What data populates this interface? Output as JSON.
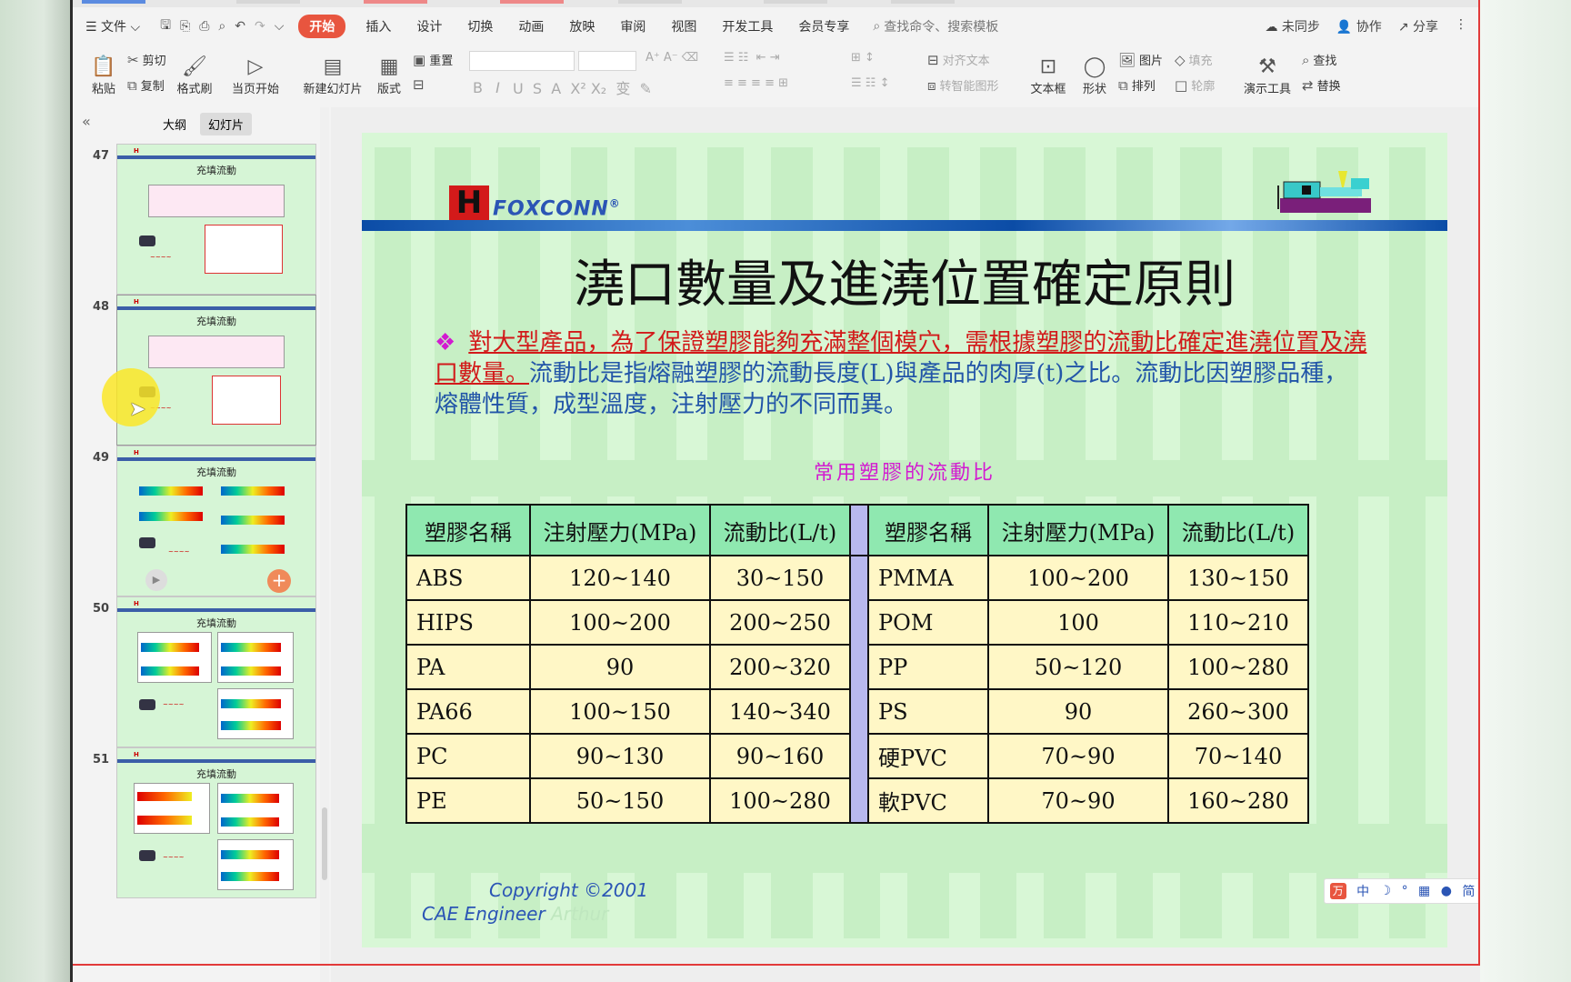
{
  "menu": {
    "file": "文件",
    "tabs": [
      "开始",
      "插入",
      "设计",
      "切换",
      "动画",
      "放映",
      "审阅",
      "视图",
      "开发工具",
      "会员专享"
    ],
    "active_tab": "开始",
    "search_placeholder": "查找命令、搜索模板",
    "sync": "未同步",
    "collab": "协作",
    "share": "分享"
  },
  "ribbon": {
    "paste": "粘贴",
    "cut": "剪切",
    "copy": "复制",
    "format_painter": "格式刷",
    "from_current": "当页开始",
    "new_slide": "新建幻灯片",
    "layout": "版式",
    "reset": "重置",
    "align_text": "对齐文本",
    "smart_shape": "转智能图形",
    "textbox": "文本框",
    "shape": "形状",
    "picture": "图片",
    "arrange": "排列",
    "fill": "填充",
    "outline": "轮廓",
    "present_tools": "演示工具",
    "find": "查找",
    "replace": "替换"
  },
  "panel": {
    "outline_tab": "大纲",
    "slides_tab": "幻灯片",
    "thumbnails": [
      {
        "num": "47",
        "title": "充填流動"
      },
      {
        "num": "48",
        "title": "充填流動"
      },
      {
        "num": "49",
        "title": "充填流動"
      },
      {
        "num": "50",
        "title": "充填流動"
      },
      {
        "num": "51",
        "title": "充填流動"
      }
    ]
  },
  "slide": {
    "logo_h": "H",
    "logo_text": "FOXCONN",
    "logo_mark": "®",
    "title": "澆口數量及進澆位置確定原則",
    "bullet": "❖",
    "body_underlined": "對大型產品，為了保證塑膠能夠充滿整個模穴，需根據塑膠的流動比確定進澆位置及澆口數量。",
    "body_rest": "流動比是指熔融塑膠的流動長度(L)與產品的肉厚(t)之比。流動比因塑膠品種，熔體性質，成型溫度，注射壓力的不同而異。",
    "table_caption": "常用塑膠的流動比",
    "headers": [
      "塑膠名稱",
      "注射壓力(MPa)",
      "流動比(L/t)"
    ],
    "left_rows": [
      [
        "ABS",
        "120~140",
        "30~150"
      ],
      [
        "HIPS",
        "100~200",
        "200~250"
      ],
      [
        "PA",
        "90",
        "200~320"
      ],
      [
        "PA66",
        "100~150",
        "140~340"
      ],
      [
        "PC",
        "90~130",
        "90~160"
      ],
      [
        "PE",
        "50~150",
        "100~280"
      ]
    ],
    "right_rows": [
      [
        "PMMA",
        "100~200",
        "130~150"
      ],
      [
        "POM",
        "100",
        "110~210"
      ],
      [
        "PP",
        "50~120",
        "100~280"
      ],
      [
        "PS",
        "90",
        "260~300"
      ],
      [
        "硬PVC",
        "70~90",
        "70~140"
      ],
      [
        "軟PVC",
        "70~90",
        "160~280"
      ]
    ],
    "copyright": "Copyright ©2001",
    "engineer": "CAE Engineer",
    "author": "Arthur"
  },
  "ime": {
    "logo": "万",
    "items": [
      "中",
      "☽",
      "°",
      "▦",
      "●",
      "简",
      "👕",
      "⚙"
    ]
  }
}
